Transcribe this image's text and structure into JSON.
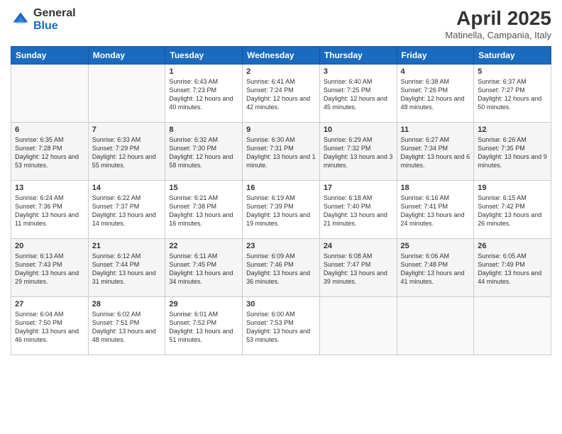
{
  "logo": {
    "general": "General",
    "blue": "Blue"
  },
  "title": "April 2025",
  "subtitle": "Matinella, Campania, Italy",
  "days_of_week": [
    "Sunday",
    "Monday",
    "Tuesday",
    "Wednesday",
    "Thursday",
    "Friday",
    "Saturday"
  ],
  "weeks": [
    [
      {
        "day": "",
        "info": ""
      },
      {
        "day": "",
        "info": ""
      },
      {
        "day": "1",
        "info": "Sunrise: 6:43 AM\nSunset: 7:23 PM\nDaylight: 12 hours and 40 minutes."
      },
      {
        "day": "2",
        "info": "Sunrise: 6:41 AM\nSunset: 7:24 PM\nDaylight: 12 hours and 42 minutes."
      },
      {
        "day": "3",
        "info": "Sunrise: 6:40 AM\nSunset: 7:25 PM\nDaylight: 12 hours and 45 minutes."
      },
      {
        "day": "4",
        "info": "Sunrise: 6:38 AM\nSunset: 7:26 PM\nDaylight: 12 hours and 48 minutes."
      },
      {
        "day": "5",
        "info": "Sunrise: 6:37 AM\nSunset: 7:27 PM\nDaylight: 12 hours and 50 minutes."
      }
    ],
    [
      {
        "day": "6",
        "info": "Sunrise: 6:35 AM\nSunset: 7:28 PM\nDaylight: 12 hours and 53 minutes."
      },
      {
        "day": "7",
        "info": "Sunrise: 6:33 AM\nSunset: 7:29 PM\nDaylight: 12 hours and 55 minutes."
      },
      {
        "day": "8",
        "info": "Sunrise: 6:32 AM\nSunset: 7:30 PM\nDaylight: 12 hours and 58 minutes."
      },
      {
        "day": "9",
        "info": "Sunrise: 6:30 AM\nSunset: 7:31 PM\nDaylight: 13 hours and 1 minute."
      },
      {
        "day": "10",
        "info": "Sunrise: 6:29 AM\nSunset: 7:32 PM\nDaylight: 13 hours and 3 minutes."
      },
      {
        "day": "11",
        "info": "Sunrise: 6:27 AM\nSunset: 7:34 PM\nDaylight: 13 hours and 6 minutes."
      },
      {
        "day": "12",
        "info": "Sunrise: 6:26 AM\nSunset: 7:35 PM\nDaylight: 13 hours and 9 minutes."
      }
    ],
    [
      {
        "day": "13",
        "info": "Sunrise: 6:24 AM\nSunset: 7:36 PM\nDaylight: 13 hours and 11 minutes."
      },
      {
        "day": "14",
        "info": "Sunrise: 6:22 AM\nSunset: 7:37 PM\nDaylight: 13 hours and 14 minutes."
      },
      {
        "day": "15",
        "info": "Sunrise: 6:21 AM\nSunset: 7:38 PM\nDaylight: 13 hours and 16 minutes."
      },
      {
        "day": "16",
        "info": "Sunrise: 6:19 AM\nSunset: 7:39 PM\nDaylight: 13 hours and 19 minutes."
      },
      {
        "day": "17",
        "info": "Sunrise: 6:18 AM\nSunset: 7:40 PM\nDaylight: 13 hours and 21 minutes."
      },
      {
        "day": "18",
        "info": "Sunrise: 6:16 AM\nSunset: 7:41 PM\nDaylight: 13 hours and 24 minutes."
      },
      {
        "day": "19",
        "info": "Sunrise: 6:15 AM\nSunset: 7:42 PM\nDaylight: 13 hours and 26 minutes."
      }
    ],
    [
      {
        "day": "20",
        "info": "Sunrise: 6:13 AM\nSunset: 7:43 PM\nDaylight: 13 hours and 29 minutes."
      },
      {
        "day": "21",
        "info": "Sunrise: 6:12 AM\nSunset: 7:44 PM\nDaylight: 13 hours and 31 minutes."
      },
      {
        "day": "22",
        "info": "Sunrise: 6:11 AM\nSunset: 7:45 PM\nDaylight: 13 hours and 34 minutes."
      },
      {
        "day": "23",
        "info": "Sunrise: 6:09 AM\nSunset: 7:46 PM\nDaylight: 13 hours and 36 minutes."
      },
      {
        "day": "24",
        "info": "Sunrise: 6:08 AM\nSunset: 7:47 PM\nDaylight: 13 hours and 39 minutes."
      },
      {
        "day": "25",
        "info": "Sunrise: 6:06 AM\nSunset: 7:48 PM\nDaylight: 13 hours and 41 minutes."
      },
      {
        "day": "26",
        "info": "Sunrise: 6:05 AM\nSunset: 7:49 PM\nDaylight: 13 hours and 44 minutes."
      }
    ],
    [
      {
        "day": "27",
        "info": "Sunrise: 6:04 AM\nSunset: 7:50 PM\nDaylight: 13 hours and 46 minutes."
      },
      {
        "day": "28",
        "info": "Sunrise: 6:02 AM\nSunset: 7:51 PM\nDaylight: 13 hours and 48 minutes."
      },
      {
        "day": "29",
        "info": "Sunrise: 6:01 AM\nSunset: 7:52 PM\nDaylight: 13 hours and 51 minutes."
      },
      {
        "day": "30",
        "info": "Sunrise: 6:00 AM\nSunset: 7:53 PM\nDaylight: 13 hours and 53 minutes."
      },
      {
        "day": "",
        "info": ""
      },
      {
        "day": "",
        "info": ""
      },
      {
        "day": "",
        "info": ""
      }
    ]
  ]
}
